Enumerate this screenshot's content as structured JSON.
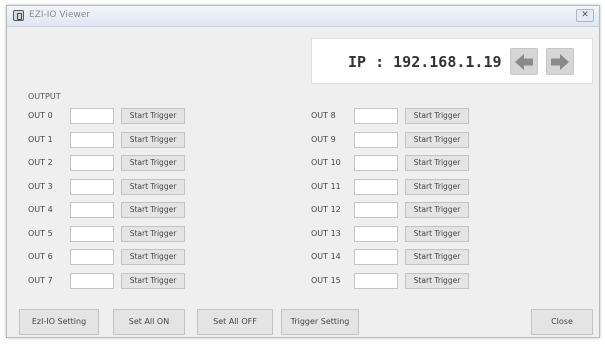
{
  "window": {
    "title": "EZI-IO Viewer",
    "close_glyph": "✕"
  },
  "ip": {
    "text": "IP : 192.168.1.19"
  },
  "icons": {
    "left": "arrow-left-icon",
    "right": "arrow-right-icon",
    "app": "app-icon"
  },
  "outputs": {
    "section_label": "OUTPUT",
    "trigger_label": "Start Trigger",
    "left": [
      "OUT 0",
      "OUT 1",
      "OUT 2",
      "OUT 3",
      "OUT 4",
      "OUT 5",
      "OUT 6",
      "OUT 7"
    ],
    "right": [
      "OUT 8",
      "OUT 9",
      "OUT 10",
      "OUT 11",
      "OUT 12",
      "OUT 13",
      "OUT 14",
      "OUT 15"
    ],
    "values": [
      "",
      "",
      "",
      "",
      "",
      "",
      "",
      "",
      "",
      "",
      "",
      "",
      "",
      "",
      "",
      ""
    ]
  },
  "bottom": {
    "ezi_setting": "EzI-IO Setting",
    "set_all_on": "Set All ON",
    "set_all_off": "Set All OFF",
    "trigger_setting": "Trigger Setting",
    "close": "Close"
  },
  "colors": {
    "window_bg": "#efefef",
    "arrow_gray": "#8a8a8a"
  }
}
